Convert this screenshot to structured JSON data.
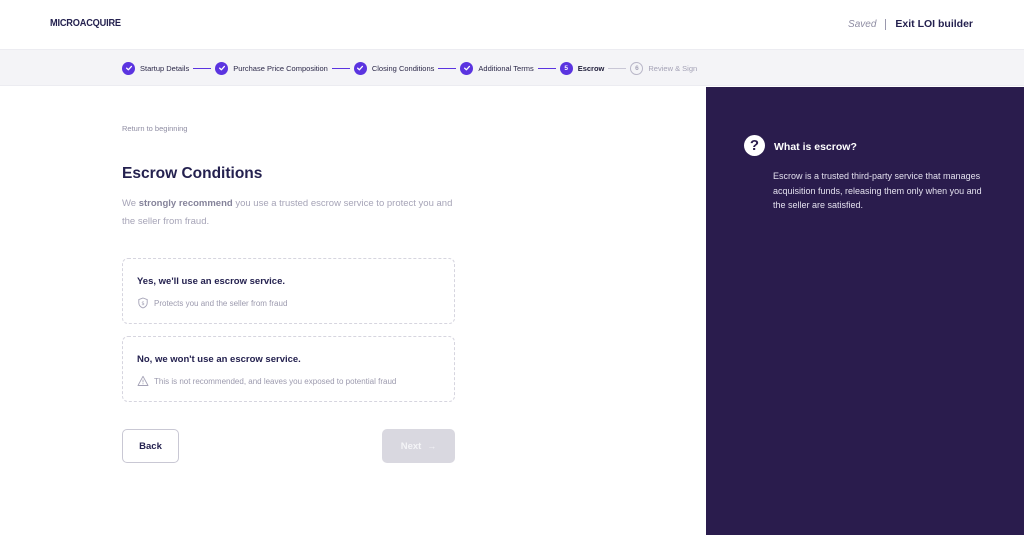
{
  "header": {
    "logo": "MICROACQUIRE",
    "saved": "Saved",
    "exit_label": "Exit LOI builder"
  },
  "steps": [
    {
      "number": "1",
      "label": "Startup Details",
      "status": "done"
    },
    {
      "number": "2",
      "label": "Purchase Price Composition",
      "status": "done"
    },
    {
      "number": "3",
      "label": "Closing Conditions",
      "status": "done"
    },
    {
      "number": "4",
      "label": "Additional Terms",
      "status": "done"
    },
    {
      "number": "5",
      "label": "Escrow",
      "status": "active"
    },
    {
      "number": "6",
      "label": "Review & Sign",
      "status": "todo"
    }
  ],
  "main": {
    "return_link": "Return to beginning",
    "title": "Escrow Conditions",
    "subtitle_pre": "We ",
    "subtitle_bold": "strongly recommend",
    "subtitle_post": " you use a trusted escrow service to protect you and the seller from fraud.",
    "options": [
      {
        "title": "Yes, we'll use an escrow service.",
        "note": "Protects you and the seller from fraud",
        "icon": "shield-icon"
      },
      {
        "title": "No, we won't use an escrow service.",
        "note": "This is not recommended, and leaves you exposed to potential fraud",
        "icon": "warning-icon"
      }
    ],
    "back_label": "Back",
    "next_label": "Next",
    "next_arrow": "→"
  },
  "sidebar": {
    "icon_glyph": "?",
    "title": "What is escrow?",
    "text": "Escrow is a trusted third-party service that manages acquisition funds, releasing them only when you and the seller are satisfied."
  },
  "colors": {
    "accent": "#5b34e0",
    "sidebar_bg": "#2a1c4d",
    "text_dark": "#24214f"
  }
}
